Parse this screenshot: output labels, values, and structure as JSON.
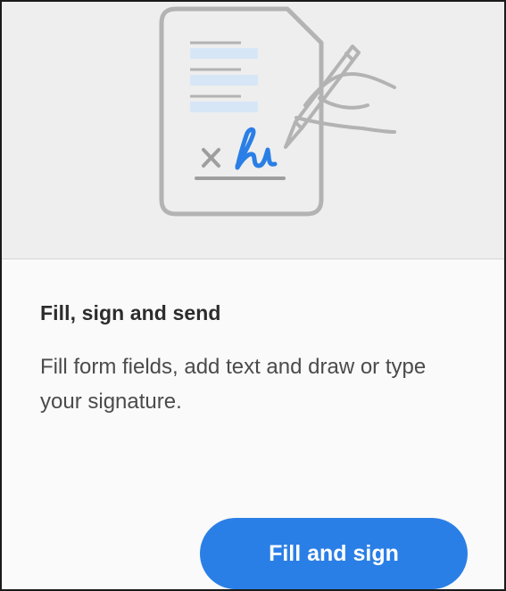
{
  "card": {
    "illustration_icon": "document-sign-icon",
    "title": "Fill, sign and send",
    "description": "Fill form fields, add text and draw or type your signature.",
    "button_label": "Fill and sign"
  },
  "colors": {
    "hero_background": "#eeeeee",
    "card_background": "#fafafa",
    "accent_blue": "#2a7fe6",
    "line_highlight": "#d7e6f7",
    "icon_gray": "#b3b3b3"
  }
}
